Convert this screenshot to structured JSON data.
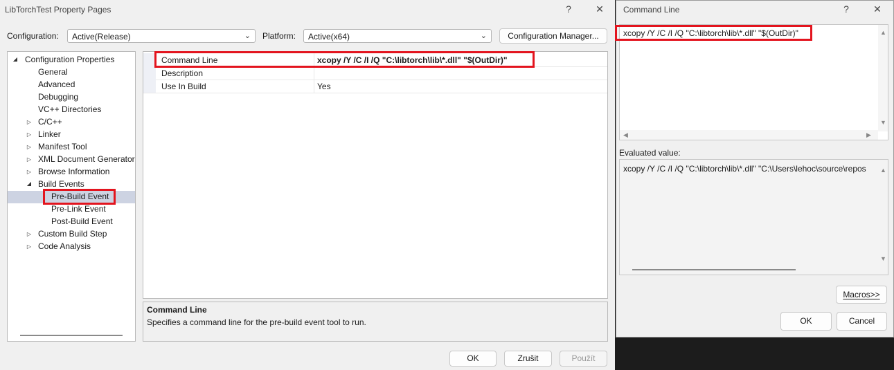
{
  "main": {
    "title": "LibTorchTest Property Pages",
    "help_glyph": "?",
    "close_glyph": "✕",
    "configuration_label": "Configuration:",
    "configuration_value": "Active(Release)",
    "platform_label": "Platform:",
    "platform_value": "Active(x64)",
    "config_manager_label": "Configuration Manager...",
    "tree": {
      "root": "Configuration Properties",
      "items": [
        "General",
        "Advanced",
        "Debugging",
        "VC++ Directories",
        "C/C++",
        "Linker",
        "Manifest Tool",
        "XML Document Generator",
        "Browse Information",
        "Build Events",
        "Pre-Build Event",
        "Pre-Link Event",
        "Post-Build Event",
        "Custom Build Step",
        "Code Analysis"
      ]
    },
    "grid": {
      "rows": [
        {
          "key": "Command Line",
          "value": "xcopy /Y /C /I /Q \"C:\\libtorch\\lib\\*.dll\" \"$(OutDir)\""
        },
        {
          "key": "Description",
          "value": ""
        },
        {
          "key": "Use In Build",
          "value": "Yes"
        }
      ]
    },
    "description": {
      "title": "Command Line",
      "text": "Specifies a command line for the pre-build event tool to run."
    },
    "buttons": {
      "ok": "OK",
      "cancel": "Zrušit",
      "apply": "Použít"
    }
  },
  "command_dialog": {
    "title": "Command Line",
    "help_glyph": "?",
    "close_glyph": "✕",
    "command_text": "xcopy /Y /C /I /Q \"C:\\libtorch\\lib\\*.dll\" \"$(OutDir)\"",
    "evaluated_label": "Evaluated value:",
    "evaluated_text": "xcopy /Y /C /I /Q \"C:\\libtorch\\lib\\*.dll\" \"C:\\Users\\lehoc\\source\\repos",
    "macros_label": "Macros>>",
    "ok_label": "OK",
    "cancel_label": "Cancel"
  },
  "icons": {
    "expand": "▷",
    "collapse": "◢",
    "chevron": "⌄",
    "up": "▲",
    "down": "▼",
    "left": "◀",
    "right": "▶"
  },
  "colors": {
    "highlight_box": "#e3141e",
    "selection": "#cdd3e2"
  }
}
